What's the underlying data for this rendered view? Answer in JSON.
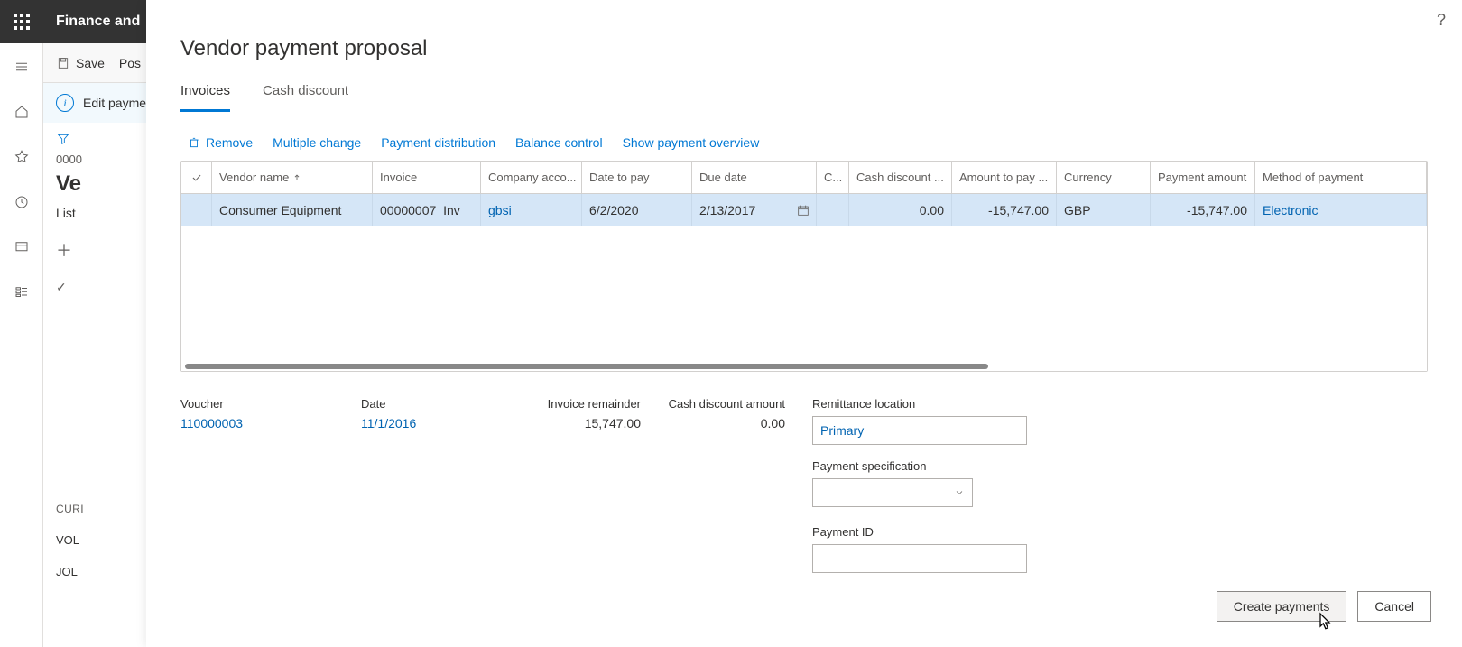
{
  "app_title": "Finance and",
  "commands": {
    "save": "Save",
    "post": "Pos"
  },
  "editbar": {
    "text": "Edit paymer"
  },
  "background": {
    "breadcrumb": "0000",
    "heading": "Ve",
    "list_tab": "List",
    "section": "CURI",
    "voucher_label": "VOL",
    "journal_label": "JOL"
  },
  "modal": {
    "title": "Vendor payment proposal",
    "tabs": {
      "invoices": "Invoices",
      "cash_discount": "Cash discount"
    },
    "toolbar": {
      "remove": "Remove",
      "multiple_change": "Multiple change",
      "payment_distribution": "Payment distribution",
      "balance_control": "Balance control",
      "show_overview": "Show payment overview"
    },
    "grid": {
      "headers": {
        "vendor_name": "Vendor name",
        "invoice": "Invoice",
        "company": "Company acco...",
        "date_to_pay": "Date to pay",
        "due_date": "Due date",
        "c": "C...",
        "cash_discount": "Cash discount ...",
        "amount_to_pay": "Amount to pay ...",
        "currency": "Currency",
        "payment_amount": "Payment amount",
        "method": "Method of payment"
      },
      "row": {
        "vendor_name": "Consumer Equipment",
        "invoice": "00000007_Inv",
        "company": "gbsi",
        "date_to_pay": "6/2/2020",
        "due_date": "2/13/2017",
        "cash_discount": "0.00",
        "amount_to_pay": "-15,747.00",
        "currency": "GBP",
        "payment_amount": "-15,747.00",
        "method": "Electronic"
      }
    },
    "details": {
      "voucher_label": "Voucher",
      "voucher_value": "110000003",
      "date_label": "Date",
      "date_value": "11/1/2016",
      "invoice_remainder_label": "Invoice remainder",
      "invoice_remainder_value": "15,747.00",
      "cash_discount_label": "Cash discount amount",
      "cash_discount_value": "0.00",
      "remittance_label": "Remittance location",
      "remittance_value": "Primary",
      "payment_spec_label": "Payment specification",
      "payment_id_label": "Payment ID"
    },
    "footer": {
      "create": "Create payments",
      "cancel": "Cancel"
    }
  }
}
